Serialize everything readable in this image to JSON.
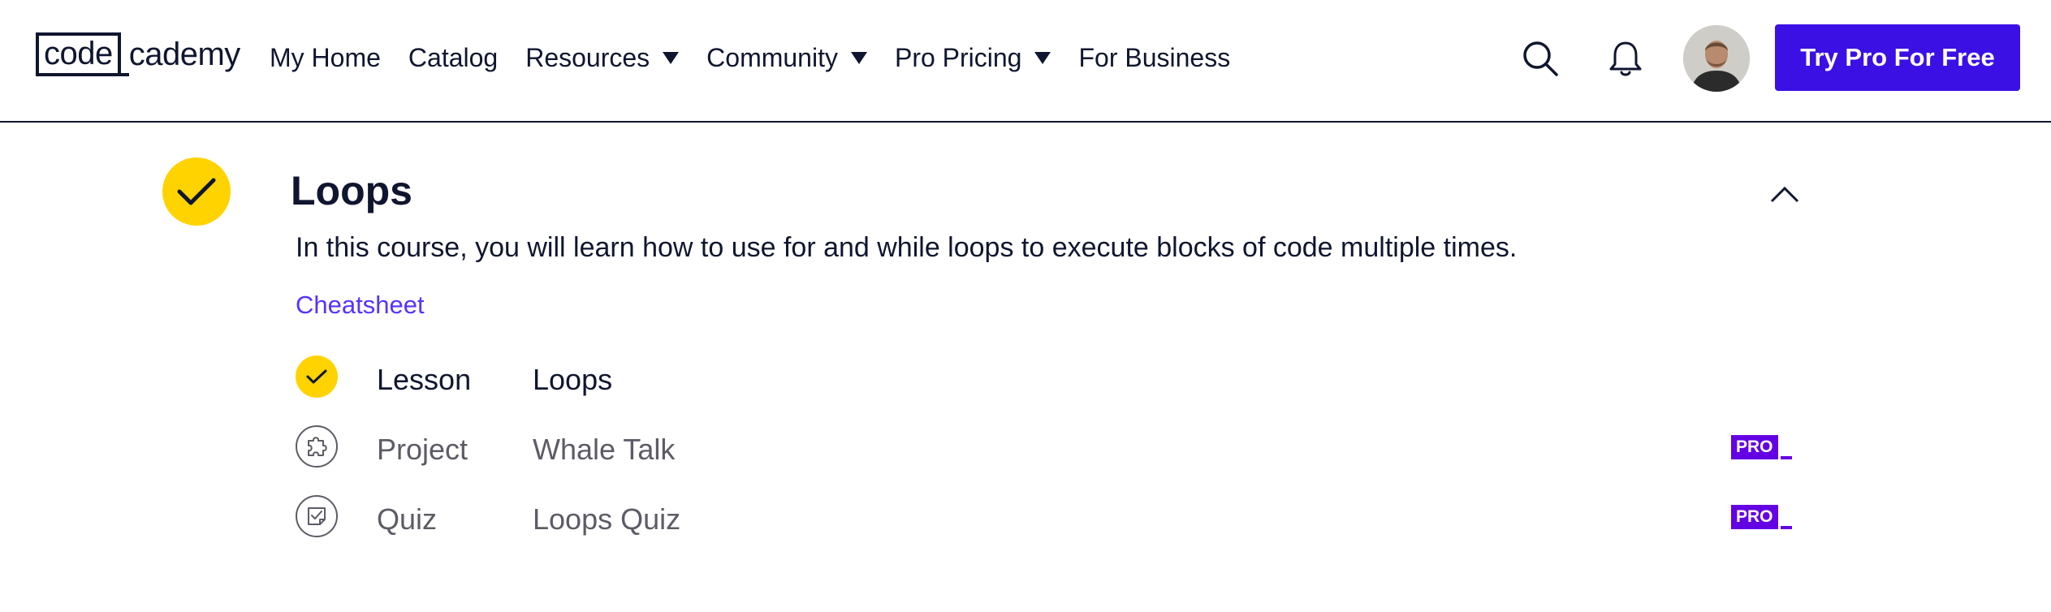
{
  "header": {
    "logo": {
      "boxed_text": "code",
      "rest_text": "cademy"
    },
    "nav": [
      {
        "label": "My Home",
        "has_dropdown": false
      },
      {
        "label": "Catalog",
        "has_dropdown": false
      },
      {
        "label": "Resources",
        "has_dropdown": true
      },
      {
        "label": "Community",
        "has_dropdown": true
      },
      {
        "label": "Pro Pricing",
        "has_dropdown": true
      },
      {
        "label": "For Business",
        "has_dropdown": false
      }
    ],
    "icons": {
      "search": "search-icon",
      "notifications": "bell-icon",
      "avatar": "user-avatar"
    },
    "cta_label": "Try Pro For Free"
  },
  "module": {
    "title": "Loops",
    "completed": true,
    "description": "In this course, you will learn how to use for and while loops to execute blocks of code multiple times.",
    "cheatsheet_label": "Cheatsheet",
    "items": [
      {
        "type": "Lesson",
        "name": "Loops",
        "status": "completed",
        "pro": false,
        "icon": "check-icon"
      },
      {
        "type": "Project",
        "name": "Whale Talk",
        "status": "not-started",
        "pro": true,
        "pro_label": "PRO",
        "icon": "puzzle-icon"
      },
      {
        "type": "Quiz",
        "name": "Loops Quiz",
        "status": "not-started",
        "pro": true,
        "pro_label": "PRO",
        "icon": "quiz-icon"
      }
    ]
  },
  "colors": {
    "brand_dark": "#10162f",
    "cta_blue": "#3a10e5",
    "link_purple": "#5533ff",
    "pro_purple": "#6400e4",
    "complete_yellow": "#ffd300",
    "muted_text": "#5c5c66"
  }
}
